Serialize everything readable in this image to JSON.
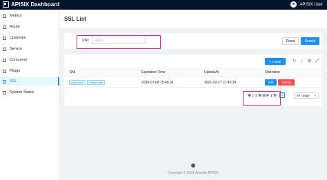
{
  "header": {
    "app_title": "APISIX Dashboard",
    "user_label": "APISIX User"
  },
  "sidebar": {
    "items": [
      {
        "label": "Metrics",
        "icon": "dashboard-icon"
      },
      {
        "label": "Route",
        "icon": "route-icon"
      },
      {
        "label": "Upstream",
        "icon": "upstream-icon"
      },
      {
        "label": "Service",
        "icon": "service-icon"
      },
      {
        "label": "Consumer",
        "icon": "consumer-icon"
      },
      {
        "label": "Plugin",
        "icon": "plugin-icon"
      },
      {
        "label": "SSL",
        "icon": "ssl-icon",
        "active": true
      },
      {
        "label": "System Status",
        "icon": "status-icon"
      }
    ]
  },
  "page": {
    "title": "SSL List"
  },
  "search": {
    "sni_label": "SNI:",
    "sni_placeholder": "请输入",
    "reset_label": "Reset",
    "search_label": "Search"
  },
  "table": {
    "create_label": "+ Create",
    "columns": [
      "SNI",
      "Expiration Time",
      "UpdateAt",
      "Operation"
    ],
    "rows": [
      {
        "sni": [
          "route.com",
          "*.route.com"
        ],
        "expiration": "2030-07-08 15:48:02",
        "updated_at": "2021-02-17 21:45:28",
        "edit_label": "Edit",
        "delete_label": "Delete"
      }
    ]
  },
  "pagination": {
    "total_text": "第 1-1 条/总共 1 条",
    "current_page": "1",
    "page_size": "20 / page"
  },
  "footer": {
    "copyright": "Copyright © 2021 Apache APISIX"
  },
  "colors": {
    "primary": "#1890ff",
    "danger": "#ff4d4f",
    "header_bg": "#001529",
    "highlight": "#e0278a"
  }
}
